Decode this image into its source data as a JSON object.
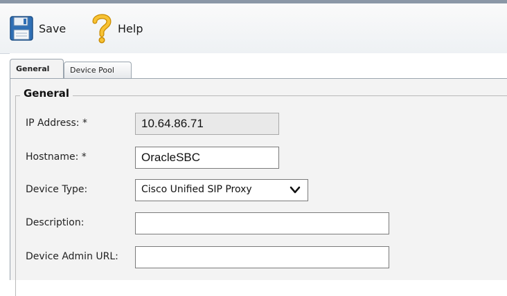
{
  "toolbar": {
    "save_label": "Save",
    "help_label": "Help"
  },
  "tabs": [
    {
      "label": "General",
      "active": true
    },
    {
      "label": "Device Pool",
      "active": false
    }
  ],
  "section": {
    "legend": "General"
  },
  "form": {
    "ip_address": {
      "label": "IP Address: *",
      "value": "10.64.86.71"
    },
    "hostname": {
      "label": "Hostname: *",
      "value": "OracleSBC"
    },
    "device_type": {
      "label": "Device Type:",
      "value": "Cisco Unified SIP Proxy"
    },
    "description": {
      "label": "Description:",
      "value": ""
    },
    "device_admin_url": {
      "label": "Device Admin URL:",
      "value": ""
    }
  },
  "icons": {
    "save": "floppy-disk-icon",
    "help": "question-mark-icon",
    "dropdown": "chevron-down-icon"
  },
  "colors": {
    "help_icon": "#f2b21a",
    "floppy_icon": "#2f6fb5"
  }
}
